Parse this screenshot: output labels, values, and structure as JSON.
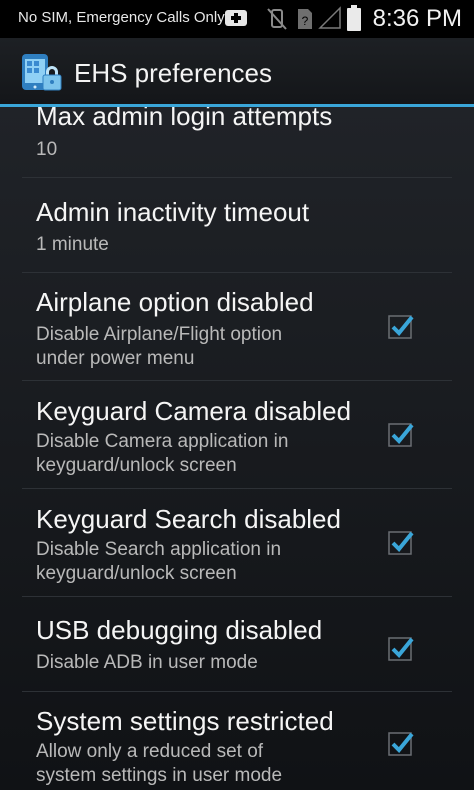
{
  "status_bar": {
    "carrier": "No SIM, Emergency Calls Only",
    "time": "8:36 PM"
  },
  "action_bar": {
    "title": "EHS preferences",
    "accent_color": "#3aa6d9"
  },
  "preferences": [
    {
      "title": "Max admin login attempts",
      "summary": "10"
    },
    {
      "title": "Admin inactivity timeout",
      "summary": "1 minute"
    },
    {
      "title": "Airplane option disabled",
      "summary_line1": "Disable Airplane/Flight option",
      "summary_line2": "under power menu",
      "checked": true
    },
    {
      "title": "Keyguard Camera disabled",
      "summary_line1": "Disable Camera application in",
      "summary_line2": "keyguard/unlock screen",
      "checked": true
    },
    {
      "title": "Keyguard Search disabled",
      "summary_line1": "Disable Search application in",
      "summary_line2": "keyguard/unlock screen",
      "checked": true
    },
    {
      "title": "USB debugging disabled",
      "summary": "Disable ADB in user mode",
      "checked": true
    },
    {
      "title": "System settings restricted",
      "summary_line1": "Allow only a reduced set of",
      "summary_line2": "system settings in user mode",
      "checked": true
    }
  ]
}
